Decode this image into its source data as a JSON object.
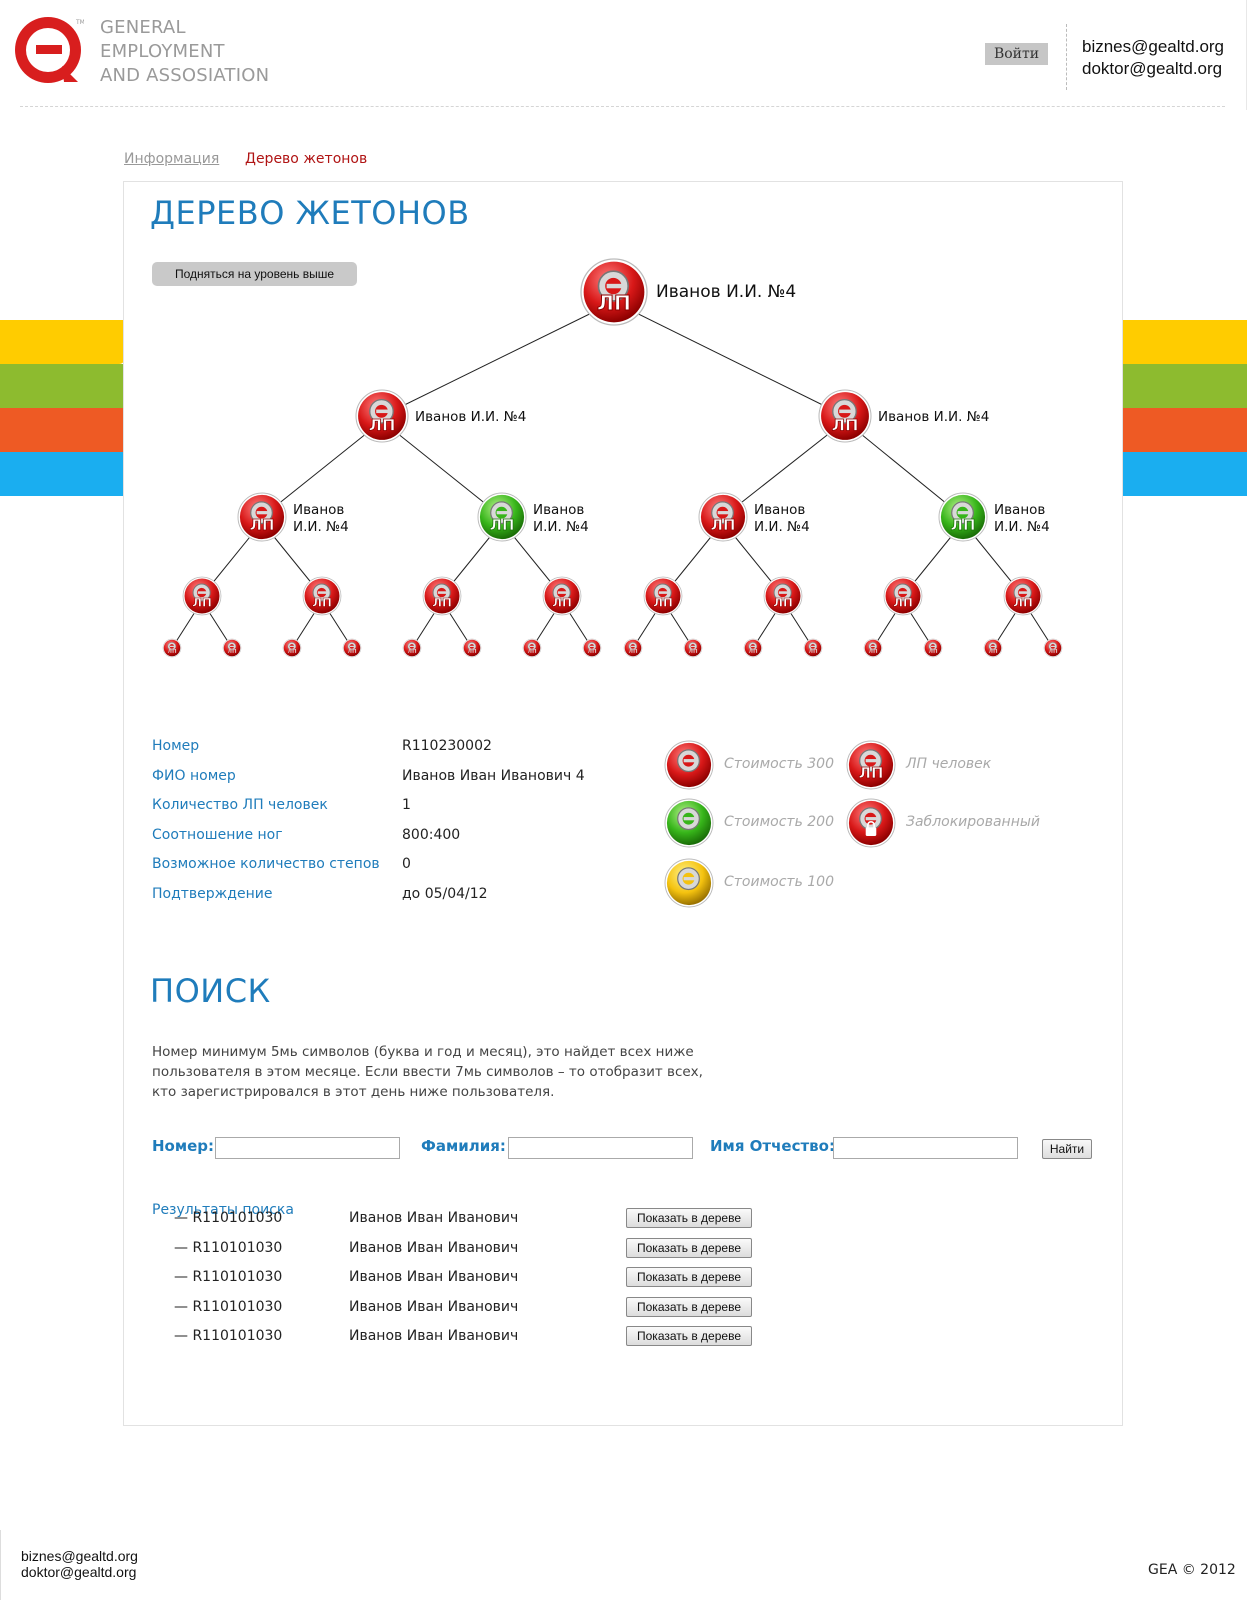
{
  "header": {
    "logo_line1": "General",
    "logo_line2": "Employment",
    "logo_line3": "and Assosiation",
    "login_label": "Войти",
    "email1": "biznes@gealtd.org",
    "email2": "doktor@gealtd.org"
  },
  "breadcrumb": {
    "info": "Информация",
    "current": "Дерево жетонов"
  },
  "tree_section": {
    "title": "ДЕРЕВО ЖЕТОНОВ",
    "up_button": "Подняться на уровень выше",
    "token_badge": "ЛП",
    "root_name": "Иванов И.И. №4",
    "level1": [
      "Иванов И.И. №4",
      "Иванов И.И. №4"
    ],
    "level2_line1": "Иванов",
    "level2_line2": "И.И. №4",
    "level2_colors": [
      "red",
      "green",
      "red",
      "green"
    ]
  },
  "info": {
    "rows": [
      {
        "label": "Номер",
        "value": "R110230002"
      },
      {
        "label": "ФИО номер",
        "value": "Иванов Иван Иванович 4"
      },
      {
        "label": "Количество ЛП человек",
        "value": "1"
      },
      {
        "label": "Соотношение ног",
        "value": "800:400"
      },
      {
        "label": "Возможное количество степов",
        "value": "0"
      },
      {
        "label": "Подтверждение",
        "value": "до 05/04/12"
      }
    ]
  },
  "legend": {
    "cost300": "Стоимость 300",
    "cost200": "Стоимость 200",
    "cost100": "Стоимость 100",
    "lp_people": "ЛП человек",
    "blocked": "Заблокированный"
  },
  "search": {
    "title": "ПОИСК",
    "description": "Номер минимум 5мь символов (буква и год и месяц), это найдет всех ниже пользователя в этом месяце. Если ввести 7мь символов – то отобразит всех, кто зарегистрировался в этот день ниже пользователя.",
    "number_label": "Номер:",
    "surname_label": "Фамилия:",
    "name_label": "Имя Отчество:",
    "number_value": "",
    "surname_value": "",
    "name_value": "",
    "find_button": "Найти",
    "results_title": "Результаты поиска",
    "results": [
      {
        "number": "— R110101030",
        "name": "Иванов Иван Иванович",
        "button": "Показать в дереве"
      },
      {
        "number": "— R110101030",
        "name": "Иванов Иван Иванович",
        "button": "Показать в дереве"
      },
      {
        "number": "— R110101030",
        "name": "Иванов Иван Иванович",
        "button": "Показать в дереве"
      },
      {
        "number": "— R110101030",
        "name": "Иванов Иван Иванович",
        "button": "Показать в дереве"
      },
      {
        "number": "— R110101030",
        "name": "Иванов Иван Иванович",
        "button": "Показать в дереве"
      }
    ]
  },
  "footer": {
    "email1": "biznes@gealtd.org",
    "email2": "doktor@gealtd.org",
    "copyright": "GEA © 2012"
  },
  "colors": {
    "brand_red": "#d81e1e",
    "accent_blue": "#1f7cbb",
    "stripe_yellow": "#ffcc00",
    "stripe_green": "#8dbb2f",
    "stripe_orange": "#ee5a24",
    "stripe_blue": "#1aaef0"
  }
}
